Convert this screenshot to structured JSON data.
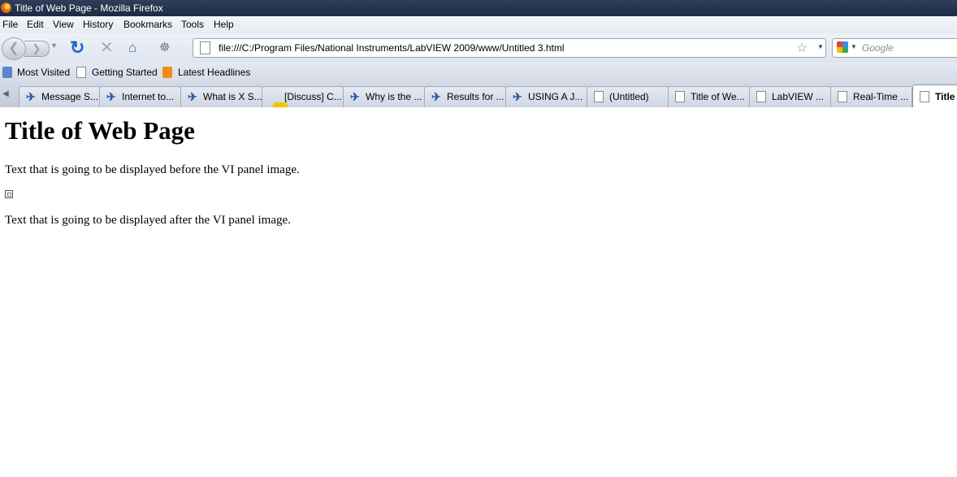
{
  "window": {
    "title": "Title of Web Page - Mozilla Firefox"
  },
  "menu": {
    "items": [
      "File",
      "Edit",
      "View",
      "History",
      "Bookmarks",
      "Tools",
      "Help"
    ]
  },
  "navigation": {
    "url": "file:///C:/Program Files/National Instruments/LabVIEW 2009/www/Untitled 3.html",
    "search_engine_icon": "google-icon",
    "search_placeholder": "Google"
  },
  "bookmarks": {
    "items": [
      {
        "label": "Most Visited",
        "icon": "most-visited-icon"
      },
      {
        "label": "Getting Started",
        "icon": "page-icon"
      },
      {
        "label": "Latest Headlines",
        "icon": "rss-icon"
      }
    ]
  },
  "tabs": [
    {
      "label": "Message S...",
      "icon": "ni-eagle-icon"
    },
    {
      "label": "Internet to...",
      "icon": "ni-eagle-icon"
    },
    {
      "label": "What is X S...",
      "icon": "ni-eagle-icon"
    },
    {
      "label": "[Discuss] C...",
      "icon": "warning-icon"
    },
    {
      "label": "Why is the ...",
      "icon": "ni-eagle-icon"
    },
    {
      "label": "Results for ...",
      "icon": "ni-eagle-icon"
    },
    {
      "label": "USING A J...",
      "icon": "ni-eagle-icon"
    },
    {
      "label": "(Untitled)",
      "icon": "page-icon"
    },
    {
      "label": "Title of We...",
      "icon": "page-icon"
    },
    {
      "label": "LabVIEW ...",
      "icon": "page-icon"
    },
    {
      "label": "Real-Time ...",
      "icon": "page-icon"
    },
    {
      "label": "Title",
      "icon": "page-icon",
      "active": true
    }
  ],
  "page": {
    "heading": "Title of Web Page",
    "text_before": "Text that is going to be displayed before the VI panel image.",
    "broken_image_icon": "broken-image-icon",
    "text_after": "Text that is going to be displayed after the VI panel image."
  }
}
